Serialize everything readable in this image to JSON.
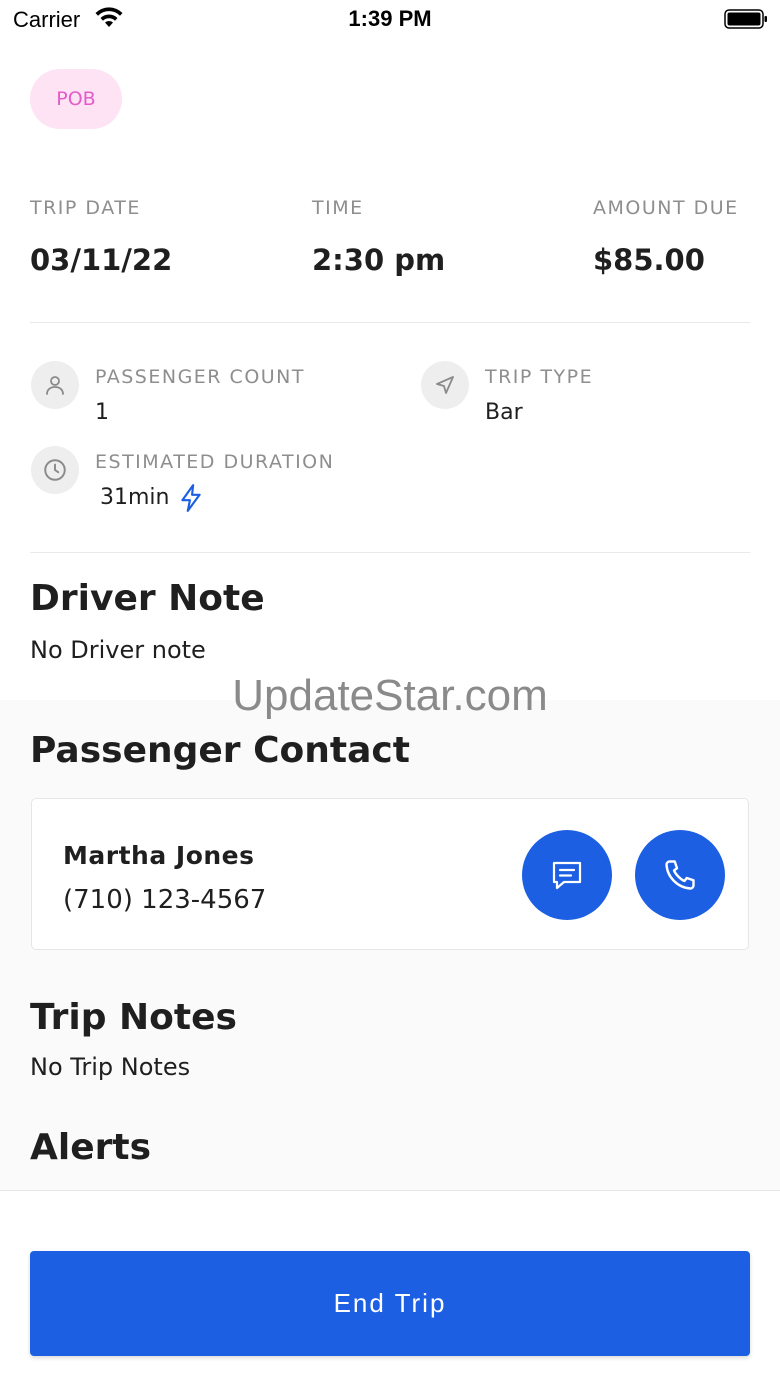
{
  "status_bar": {
    "carrier": "Carrier",
    "time": "1:39 PM"
  },
  "badge": {
    "label": "POB"
  },
  "trip_info": {
    "date_label": "TRIP DATE",
    "date_value": "03/11/22",
    "time_label": "TIME",
    "time_value": "2:30 pm",
    "amount_label": "AMOUNT DUE",
    "amount_value": "$85.00"
  },
  "details": {
    "passenger_count_label": "PASSENGER COUNT",
    "passenger_count_value": "1",
    "trip_type_label": "TRIP TYPE",
    "trip_type_value": "Bar",
    "duration_label": "ESTIMATED DURATION",
    "duration_value": "31min"
  },
  "driver_note": {
    "title": "Driver Note",
    "text": "No Driver note"
  },
  "watermark": "UpdateStar.com",
  "passenger_contact": {
    "title": "Passenger Contact",
    "name": "Martha Jones",
    "phone": "(710) 123-4567"
  },
  "trip_notes": {
    "title": "Trip Notes",
    "text": "No Trip Notes"
  },
  "alerts": {
    "title": "Alerts"
  },
  "actions": {
    "end_trip": "End Trip"
  },
  "colors": {
    "accent": "#1c5fe3",
    "badge_bg": "#fde3f4",
    "badge_text": "#e45cc8",
    "label_gray": "#8e8e8e"
  }
}
